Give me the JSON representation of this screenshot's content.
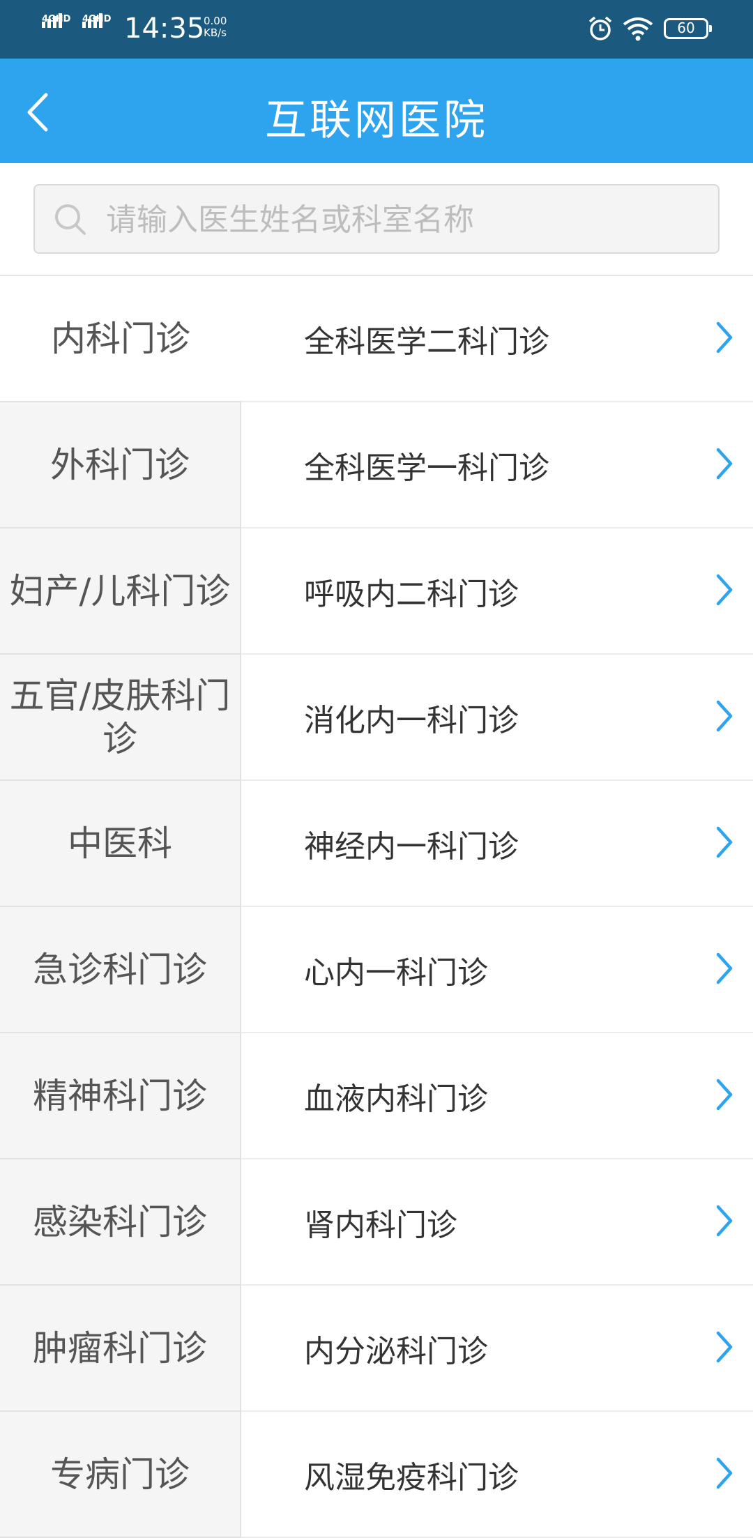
{
  "status_bar": {
    "network_1": "4GHD",
    "network_2": "4GHD",
    "time": "14:35",
    "speed_value": "0.00",
    "speed_unit": "KB/s",
    "battery": "60"
  },
  "header": {
    "title": "互联网医院",
    "back_icon": "chevron-left-icon"
  },
  "search": {
    "placeholder": "请输入医生姓名或科室名称",
    "icon": "search-icon"
  },
  "categories": [
    {
      "label": "内科门诊",
      "active": true
    },
    {
      "label": "外科门诊"
    },
    {
      "label": "妇产/儿科门诊"
    },
    {
      "label": "五官/皮肤科门诊"
    },
    {
      "label": "中医科"
    },
    {
      "label": "急诊科门诊"
    },
    {
      "label": "精神科门诊"
    },
    {
      "label": "感染科门诊"
    },
    {
      "label": "肿瘤科门诊"
    },
    {
      "label": "专病门诊"
    }
  ],
  "departments": [
    {
      "label": "全科医学二科门诊"
    },
    {
      "label": "全科医学一科门诊"
    },
    {
      "label": "呼吸内二科门诊"
    },
    {
      "label": "消化内一科门诊"
    },
    {
      "label": "神经内一科门诊"
    },
    {
      "label": "心内一科门诊"
    },
    {
      "label": "血液内科门诊"
    },
    {
      "label": "肾内科门诊"
    },
    {
      "label": "内分泌科门诊"
    },
    {
      "label": "风湿免疫科门诊"
    }
  ],
  "colors": {
    "status_bar": "#1b5a7e",
    "header": "#2ea3ee",
    "chevron": "#2ea3ee"
  }
}
